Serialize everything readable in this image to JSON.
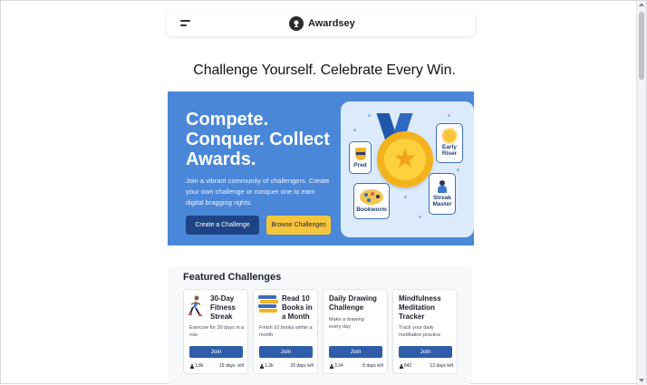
{
  "nav": {
    "brand": "Awardsey"
  },
  "headline": "Challenge Yourself. Celebrate Every Win.",
  "hero": {
    "title": "Compete. Conquer. Collect Awards.",
    "description": "Join a vibrant community of challengers. Create your own challenge or conquer one to earn digital bragging rights.",
    "create_label": "Create a Challenge",
    "browse_label": "Browse Challenges",
    "badges": {
      "pred": "Pred",
      "early": "Early Riser",
      "book": "Bookworm",
      "streak": "Streak Master"
    }
  },
  "featured": {
    "title": "Featured Challenges",
    "cards": [
      {
        "title": "30-Day Fitness Streak",
        "desc": "Exercise for 30 days in a row",
        "join": "Join",
        "participants": "1.8k",
        "days": "15 days  left"
      },
      {
        "title": "Read 10 Books in a Month",
        "desc": "Finish 10 books within a month",
        "join": "Join",
        "participants": "1.2k",
        "days": "20 days left"
      },
      {
        "title": "Daily Drawing Challenge",
        "desc": "Make a drawing every day",
        "join": "Join",
        "participants": "3.34",
        "days": "8 days left"
      },
      {
        "title": "Mindfulness Meditation Tracker",
        "desc": "Track your daily meditation practice",
        "join": "Join",
        "participants": "842",
        "days": "12 days left"
      }
    ]
  },
  "colors": {
    "hero_bg": "#4a87d9",
    "primary_button": "#1f4486",
    "accent_button": "#f7c53b",
    "join_button": "#2e5daa"
  }
}
